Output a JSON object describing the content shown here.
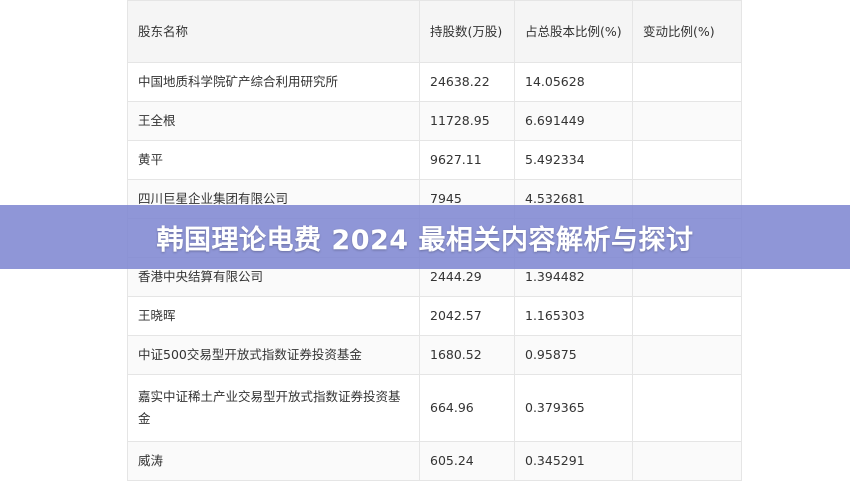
{
  "banner": {
    "title": "韩国理论电费 2024 最相关内容解析与探讨"
  },
  "table": {
    "headers": [
      "股东名称",
      "持股数(万股)",
      "占总股本比例(%)",
      "变动比例(%)"
    ],
    "rows": [
      [
        "中国地质科学院矿产综合利用研究所",
        "24638.22",
        "14.05628",
        ""
      ],
      [
        "王全根",
        "11728.95",
        "6.691449",
        ""
      ],
      [
        "黄平",
        "9627.11",
        "5.492334",
        ""
      ],
      [
        "四川巨星企业集团有限公司",
        "7945",
        "4.532681",
        ""
      ],
      [
        "",
        "",
        "",
        ""
      ],
      [
        "香港中央结算有限公司",
        "2444.29",
        "1.394482",
        ""
      ],
      [
        "王晓晖",
        "2042.57",
        "1.165303",
        ""
      ],
      [
        "中证500交易型开放式指数证券投资基金",
        "1680.52",
        "0.95875",
        ""
      ],
      [
        "嘉实中证稀土产业交易型开放式指数证券投资基金",
        "664.96",
        "0.379365",
        ""
      ],
      [
        "威涛",
        "605.24",
        "0.345291",
        ""
      ]
    ]
  }
}
